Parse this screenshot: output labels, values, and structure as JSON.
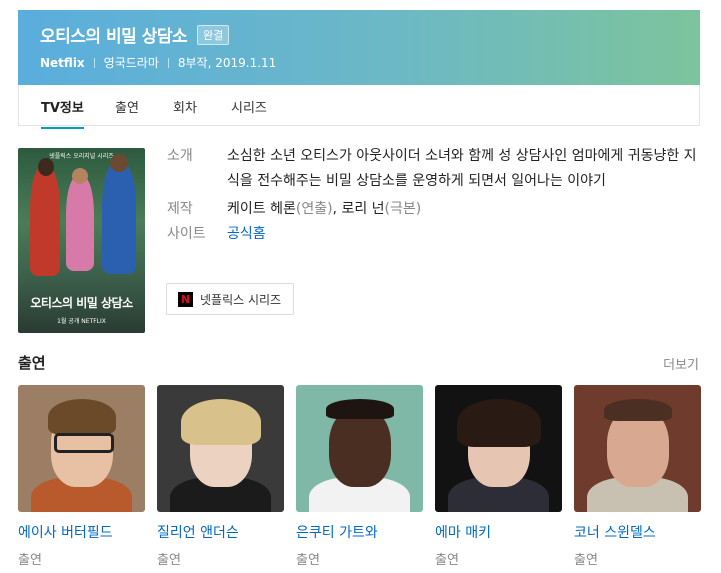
{
  "header": {
    "title": "오티스의 비밀 상담소",
    "badge": "완결",
    "meta": [
      "Netflix",
      "영국드라마",
      "8부작, 2019.1.11"
    ]
  },
  "tabs": [
    {
      "label": "TV정보",
      "active": true
    },
    {
      "label": "출연",
      "active": false
    },
    {
      "label": "회차",
      "active": false
    },
    {
      "label": "시리즈",
      "active": false
    }
  ],
  "poster": {
    "top_text": "넷플릭스 오리지널 시리즈",
    "title": "오티스의 비밀 상담소",
    "bottom_text": "1월 공개 NETFLIX"
  },
  "info": {
    "intro_label": "소개",
    "intro_text": "소심한 소년 오티스가 아웃사이더 소녀와 함께 성 상담사인 엄마에게 귀동냥한 지식을 전수해주는 비밀 상담소를 운영하게 되면서 일어나는 이야기",
    "production_label": "제작",
    "producer1": "케이트 헤론",
    "producer1_role": "(연출)",
    "separator": ", ",
    "producer2": "로리 넌",
    "producer2_role": "(극본)",
    "site_label": "사이트",
    "site_link": "공식홈",
    "netflix_button": "넷플릭스 시리즈",
    "netflix_logo": "N"
  },
  "cast": {
    "title": "출연",
    "more": "더보기",
    "members": [
      {
        "name": "에이사 버터필드",
        "role": "출연",
        "photo": "person-glasses"
      },
      {
        "name": "질리언 앤더슨",
        "role": "출연",
        "photo": "person-blonde"
      },
      {
        "name": "은쿠티 가트와",
        "role": "출연",
        "photo": "person-smiling"
      },
      {
        "name": "에마 매키",
        "role": "출연",
        "photo": "person-dark-hair"
      },
      {
        "name": "코너 스윈델스",
        "role": "출연",
        "photo": "person-short-hair"
      }
    ]
  },
  "colors": {
    "header_left": "#5aaedd",
    "header_right": "#7cc49c",
    "link": "#0068c3",
    "tab_underline": "#00a0bd",
    "netflix_red": "#e50914"
  }
}
